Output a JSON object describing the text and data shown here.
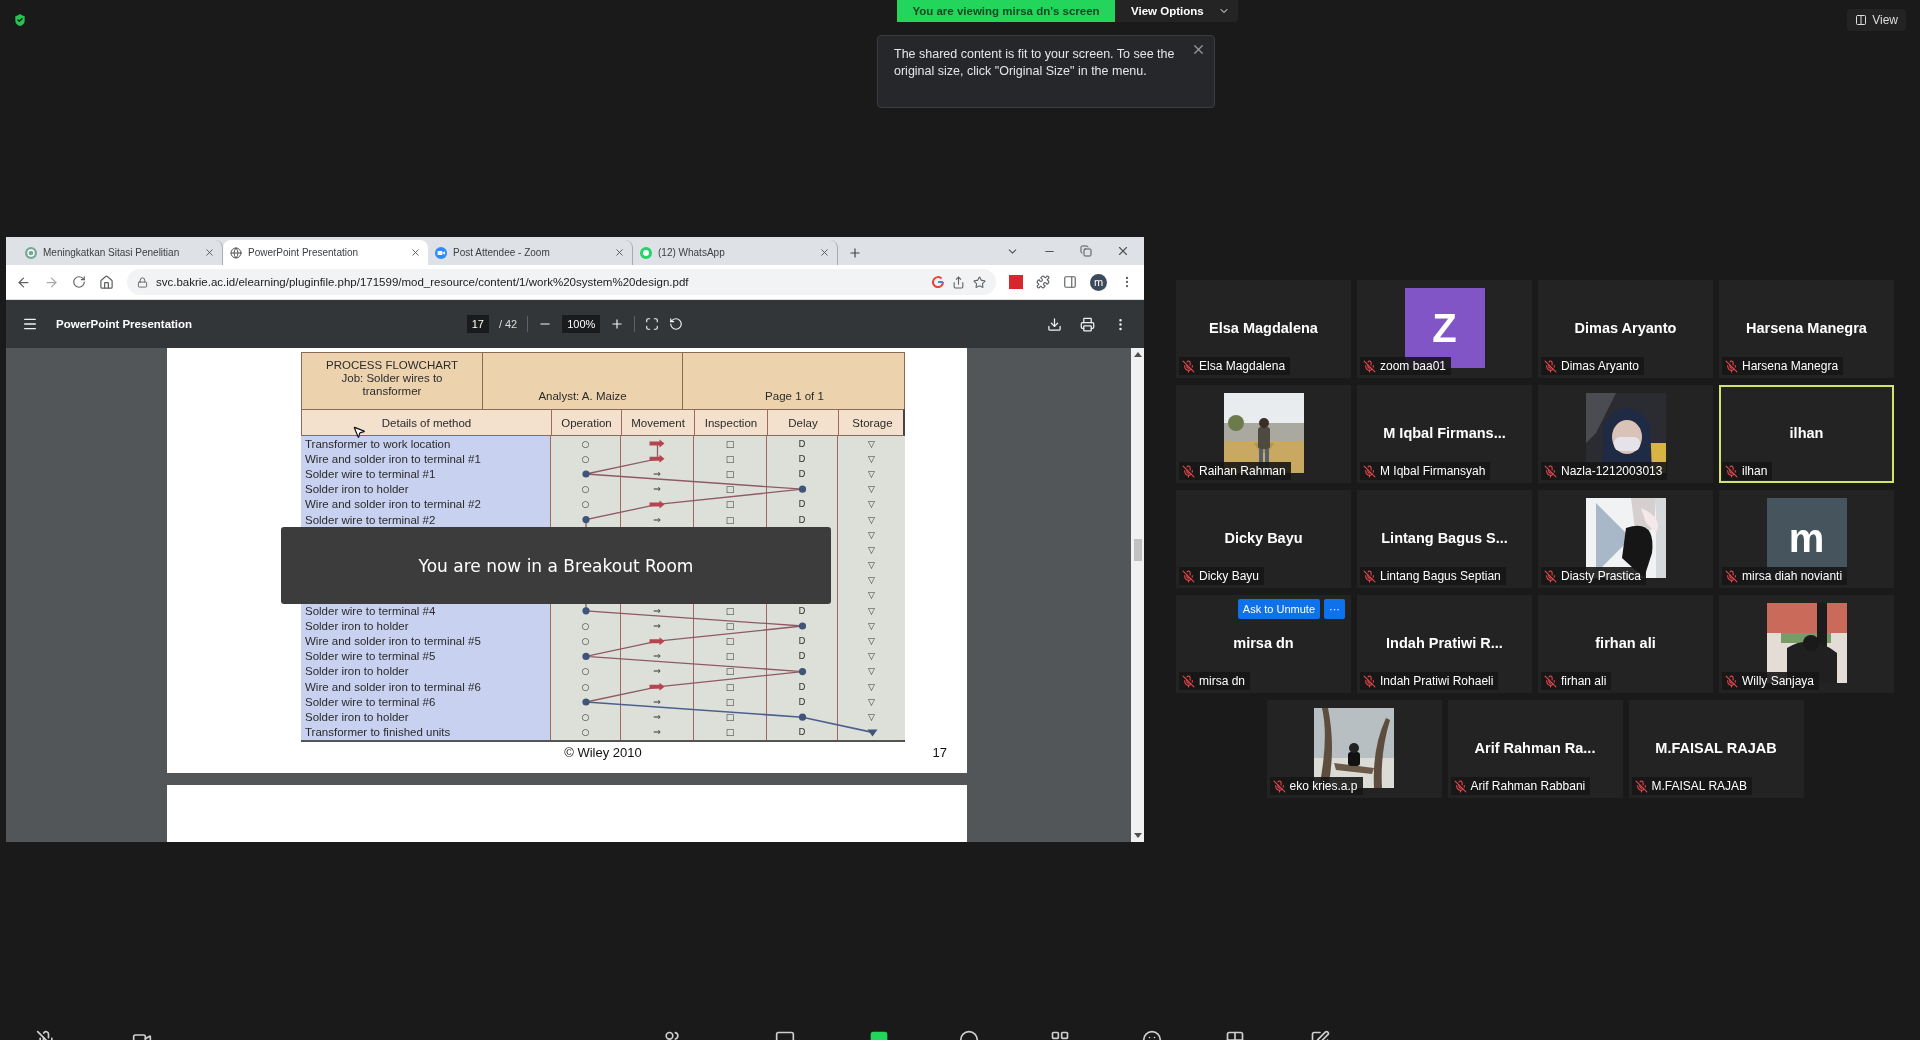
{
  "banner": {
    "text": "You are viewing mirsa dn's screen",
    "view_options": "View Options"
  },
  "tooltip": {
    "text": "The shared content is fit to your screen. To see the original size, click \"Original Size\" in the menu."
  },
  "view_button": "View",
  "browser": {
    "tabs": [
      {
        "title": "Meningkatkan Sitasi Penelitian",
        "selected": false
      },
      {
        "title": "PowerPoint Presentation",
        "selected": true
      },
      {
        "title": "Post Attendee - Zoom",
        "selected": false
      },
      {
        "title": "(12) WhatsApp",
        "selected": false
      }
    ],
    "url": "svc.bakrie.ac.id/elearning/pluginfile.php/171599/mod_resource/content/1/work%20system%20design.pdf",
    "profile": "m",
    "pdf": {
      "title": "PowerPoint Presentation",
      "page": "17",
      "total": "/ 42",
      "zoom": "100%"
    }
  },
  "slide": {
    "title": "PROCESS FLOWCHART",
    "job": "Job: Solder wires to transformer",
    "analyst": "Analyst: A. Maize",
    "page": "Page 1 of 1",
    "details_header": "Details of method",
    "columns": [
      "Operation",
      "Movement",
      "Inspection",
      "Delay",
      "Storage"
    ],
    "rows_above": [
      {
        "text": "Transformer to work location",
        "cells": [
          {
            "symbol": "○",
            "filled": false
          },
          {
            "filled": true
          },
          {
            "symbol": "□",
            "filled": false
          },
          {
            "symbol": "D",
            "filled": false
          },
          {
            "symbol": "▽",
            "filled": false
          }
        ]
      },
      {
        "text": "Wire and solder iron to terminal #1",
        "cells": [
          {
            "symbol": "○",
            "filled": false
          },
          {
            "filled": true
          },
          {
            "symbol": "□",
            "filled": false
          },
          {
            "symbol": "D",
            "filled": false
          },
          {
            "symbol": "▽",
            "filled": false
          }
        ]
      },
      {
        "text": "Solder wire to terminal #1",
        "cells": [
          {
            "filled": true
          },
          {
            "symbol": "⇒",
            "filled": false
          },
          {
            "symbol": "□",
            "filled": false
          },
          {
            "symbol": "D",
            "filled": false
          },
          {
            "symbol": "▽",
            "filled": false
          }
        ]
      },
      {
        "text": "Solder iron to holder",
        "cells": [
          {
            "symbol": "○",
            "filled": false
          },
          {
            "symbol": "⇒",
            "filled": false
          },
          {
            "symbol": "□",
            "filled": false
          },
          {
            "filled": true
          },
          {
            "symbol": "▽",
            "filled": false
          }
        ]
      },
      {
        "text": "Wire and solder iron to terminal #2",
        "cells": [
          {
            "symbol": "○",
            "filled": false
          },
          {
            "filled": true
          },
          {
            "symbol": "□",
            "filled": false
          },
          {
            "symbol": "D",
            "filled": false
          },
          {
            "symbol": "▽",
            "filled": false
          }
        ]
      },
      {
        "text": "Solder wire to terminal #2",
        "cells": [
          {
            "filled": true
          },
          {
            "symbol": "⇒",
            "filled": false
          },
          {
            "symbol": "□",
            "filled": false
          },
          {
            "symbol": "D",
            "filled": false
          },
          {
            "symbol": "▽",
            "filled": false
          }
        ]
      }
    ],
    "covered_storage": [
      {
        "symbol": "▽",
        "filled": false
      },
      {
        "symbol": "▽",
        "filled": false
      },
      {
        "symbol": "▽",
        "filled": false
      },
      {
        "symbol": "▽",
        "filled": false
      },
      {
        "symbol": "▽",
        "filled": false
      }
    ],
    "rows_below": [
      {
        "text": "Solder wire to terminal #4",
        "cells": [
          {
            "filled": true
          },
          {
            "symbol": "⇒",
            "filled": false
          },
          {
            "symbol": "□",
            "filled": false
          },
          {
            "symbol": "D",
            "filled": false
          },
          {
            "symbol": "▽",
            "filled": false
          }
        ]
      },
      {
        "text": "Solder iron to holder",
        "cells": [
          {
            "symbol": "○",
            "filled": false
          },
          {
            "symbol": "⇒",
            "filled": false
          },
          {
            "symbol": "□",
            "filled": false
          },
          {
            "filled": true
          },
          {
            "symbol": "▽",
            "filled": false
          }
        ]
      },
      {
        "text": "Wire and solder iron to terminal #5",
        "cells": [
          {
            "symbol": "○",
            "filled": false
          },
          {
            "filled": true
          },
          {
            "symbol": "□",
            "filled": false
          },
          {
            "symbol": "D",
            "filled": false
          },
          {
            "symbol": "▽",
            "filled": false
          }
        ]
      },
      {
        "text": "Solder wire to terminal #5",
        "cells": [
          {
            "filled": true
          },
          {
            "symbol": "⇒",
            "filled": false
          },
          {
            "symbol": "□",
            "filled": false
          },
          {
            "symbol": "D",
            "filled": false
          },
          {
            "symbol": "▽",
            "filled": false
          }
        ]
      },
      {
        "text": "Solder iron to holder",
        "cells": [
          {
            "symbol": "○",
            "filled": false
          },
          {
            "symbol": "⇒",
            "filled": false
          },
          {
            "symbol": "□",
            "filled": false
          },
          {
            "filled": true
          },
          {
            "symbol": "▽",
            "filled": false
          }
        ]
      },
      {
        "text": "Wire and solder iron to terminal #6",
        "cells": [
          {
            "symbol": "○",
            "filled": false
          },
          {
            "filled": true
          },
          {
            "symbol": "□",
            "filled": false
          },
          {
            "symbol": "D",
            "filled": false
          },
          {
            "symbol": "▽",
            "filled": false
          }
        ]
      },
      {
        "text": "Solder wire to terminal #6",
        "cells": [
          {
            "filled": true
          },
          {
            "symbol": "⇒",
            "filled": false
          },
          {
            "symbol": "□",
            "filled": false
          },
          {
            "symbol": "D",
            "filled": false
          },
          {
            "symbol": "▽",
            "filled": false
          }
        ]
      },
      {
        "text": "Solder iron to holder",
        "cells": [
          {
            "symbol": "○",
            "filled": false
          },
          {
            "symbol": "⇒",
            "filled": false
          },
          {
            "symbol": "□",
            "filled": false
          },
          {
            "filled": true
          },
          {
            "symbol": "▽",
            "filled": false
          }
        ]
      },
      {
        "text": "Transformer to finished units",
        "cells": [
          {
            "symbol": "○",
            "filled": false
          },
          {
            "symbol": "⇒",
            "filled": false
          },
          {
            "symbol": "□",
            "filled": false
          },
          {
            "symbol": "D",
            "filled": false
          },
          {
            "filled": true
          }
        ]
      }
    ],
    "copyright": "© Wiley 2010",
    "number": "17"
  },
  "breakout_notice": "You are now in a Breakout Room",
  "participants": [
    {
      "kind": "name",
      "display": "Elsa Magdalena",
      "name": "Elsa Magdalena",
      "muted": true,
      "speaking": false
    },
    {
      "kind": "avatar",
      "letter": "Z",
      "color": "#8155c5",
      "name": "zoom baa01",
      "muted": true,
      "speaking": false
    },
    {
      "kind": "name",
      "display": "Dimas Aryanto",
      "name": "Dimas Aryanto",
      "muted": true,
      "speaking": false
    },
    {
      "kind": "name",
      "display": "Harsena Manegra",
      "name": "Harsena Manegra",
      "muted": true,
      "speaking": false
    },
    {
      "kind": "picture",
      "name": "Raihan Rahman",
      "muted": true,
      "speaking": false
    },
    {
      "kind": "name",
      "display": "M Iqbal Firmans...",
      "name": "M Iqbal Firmansyah",
      "muted": true,
      "speaking": false
    },
    {
      "kind": "picture",
      "name": "Nazla-1212003013",
      "muted": true,
      "speaking": false
    },
    {
      "kind": "name",
      "display": "ilhan",
      "name": "ilhan",
      "muted": true,
      "speaking": true
    },
    {
      "kind": "name",
      "display": "Dicky Bayu",
      "name": "Dicky Bayu",
      "muted": true,
      "speaking": false
    },
    {
      "kind": "name",
      "display": "Lintang Bagus S...",
      "name": "Lintang Bagus Septian",
      "muted": true,
      "speaking": false
    },
    {
      "kind": "picture",
      "name": "Diasty Prastica",
      "muted": true,
      "speaking": false
    },
    {
      "kind": "avatar",
      "letter": "m",
      "color": "#46545e",
      "name": "mirsa diah novianti",
      "muted": true,
      "speaking": false
    },
    {
      "kind": "name",
      "display": "mirsa dn",
      "name": "mirsa dn",
      "muted": true,
      "speaking": false,
      "ask_to_unmute": "Ask to Unmute",
      "more": "···"
    },
    {
      "kind": "name",
      "display": "Indah Pratiwi R...",
      "name": "Indah Pratiwi Rohaeli",
      "muted": true,
      "speaking": false
    },
    {
      "kind": "name",
      "display": "firhan ali",
      "name": "firhan ali",
      "muted": true,
      "speaking": false
    },
    {
      "kind": "picture",
      "name": "Willy Sanjaya",
      "muted": true,
      "speaking": false
    },
    {
      "kind": "picture",
      "name": "eko kries.a.p",
      "muted": true,
      "speaking": false
    },
    {
      "kind": "name",
      "display": "Arif Rahman Ra...",
      "name": "Arif Rahman Rabbani",
      "muted": true,
      "speaking": false
    },
    {
      "kind": "name",
      "display": "M.FAISAL RAJAB",
      "name": "M.FAISAL RAJAB",
      "muted": true,
      "speaking": false
    }
  ]
}
